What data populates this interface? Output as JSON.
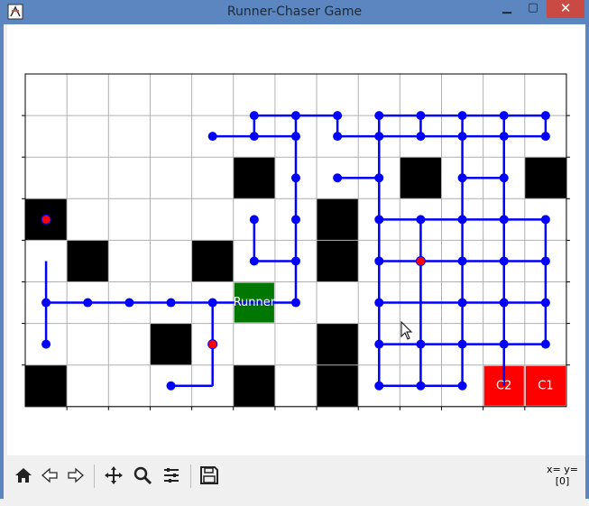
{
  "window": {
    "title": "Runner-Chaser Game"
  },
  "toolbar": {
    "buttons": [
      "home-icon",
      "back-icon",
      "forward-icon",
      "pan-icon",
      "zoom-icon",
      "configure-subplots-icon",
      "save-icon"
    ],
    "coords_line1": "x= y=",
    "coords_line2": "[0]"
  },
  "grid": {
    "cols": 13,
    "rows": 8,
    "grid_color": "#b0b0b0",
    "walls": [
      [
        5,
        2
      ],
      [
        9,
        2
      ],
      [
        12,
        2
      ],
      [
        0,
        3
      ],
      [
        7,
        3
      ],
      [
        1,
        4
      ],
      [
        4,
        4
      ],
      [
        7,
        4
      ],
      [
        3,
        6
      ],
      [
        7,
        6
      ],
      [
        0,
        7
      ],
      [
        5,
        7
      ],
      [
        7,
        7
      ]
    ],
    "runner": {
      "col": 5,
      "row": 5,
      "label": "Runner",
      "color": "#007700"
    },
    "chasers": [
      {
        "col": 11,
        "row": 7,
        "label": "C2",
        "color": "#ff0000"
      },
      {
        "col": 12,
        "row": 7,
        "label": "C1",
        "color": "#ff0000"
      }
    ],
    "edge_color": "#0000ff",
    "node_color": "#0000ff",
    "red_node_color": "#ff0000",
    "red_nodes": [
      [
        0,
        4
      ],
      [
        4,
        7
      ],
      [
        9,
        5
      ]
    ],
    "edges": [
      [
        [
          5.5,
          1
        ],
        [
          6.5,
          1
        ]
      ],
      [
        [
          6.5,
          1
        ],
        [
          7.5,
          1
        ]
      ],
      [
        [
          5.5,
          1
        ],
        [
          5.5,
          1.5
        ]
      ],
      [
        [
          6.5,
          1
        ],
        [
          6.5,
          1.5
        ]
      ],
      [
        [
          7.5,
          1
        ],
        [
          7.5,
          1.5
        ]
      ],
      [
        [
          4.5,
          1.5
        ],
        [
          5.5,
          1.5
        ]
      ],
      [
        [
          5.5,
          1.5
        ],
        [
          6.5,
          1.5
        ]
      ],
      [
        [
          6.5,
          1.5
        ],
        [
          6.5,
          2.5
        ]
      ],
      [
        [
          6.5,
          2.5
        ],
        [
          6.5,
          3.5
        ]
      ],
      [
        [
          6.5,
          3.5
        ],
        [
          6.5,
          4.5
        ]
      ],
      [
        [
          6.5,
          4.5
        ],
        [
          6.5,
          5.5
        ]
      ],
      [
        [
          5.5,
          3.5
        ],
        [
          5.5,
          4.5
        ]
      ],
      [
        [
          5.5,
          4.5
        ],
        [
          6.5,
          4.5
        ]
      ],
      [
        [
          5.5,
          5.5
        ],
        [
          6.5,
          5.5
        ]
      ],
      [
        [
          7.5,
          2.5
        ],
        [
          8.5,
          2.5
        ]
      ],
      [
        [
          7.5,
          1.5
        ],
        [
          8.5,
          1.5
        ]
      ],
      [
        [
          8.5,
          1
        ],
        [
          8.5,
          7.5
        ]
      ],
      [
        [
          9.5,
          1
        ],
        [
          9.5,
          1.5
        ]
      ],
      [
        [
          10.5,
          1
        ],
        [
          10.5,
          1.5
        ]
      ],
      [
        [
          11.5,
          1
        ],
        [
          11.5,
          1.5
        ]
      ],
      [
        [
          12.5,
          1
        ],
        [
          12.5,
          1.5
        ]
      ],
      [
        [
          8.5,
          1
        ],
        [
          12.5,
          1
        ]
      ],
      [
        [
          8.5,
          1.5
        ],
        [
          12.5,
          1.5
        ]
      ],
      [
        [
          10.5,
          1.5
        ],
        [
          10.5,
          2.5
        ]
      ],
      [
        [
          11.5,
          1.5
        ],
        [
          11.5,
          2.5
        ]
      ],
      [
        [
          10.5,
          2.5
        ],
        [
          11.5,
          2.5
        ]
      ],
      [
        [
          8.5,
          3.5
        ],
        [
          12.5,
          3.5
        ]
      ],
      [
        [
          8.5,
          4.5
        ],
        [
          12.5,
          4.5
        ]
      ],
      [
        [
          8.5,
          5.5
        ],
        [
          12.5,
          5.5
        ]
      ],
      [
        [
          8.5,
          6.5
        ],
        [
          12.5,
          6.5
        ]
      ],
      [
        [
          8.5,
          7.5
        ],
        [
          10.5,
          7.5
        ]
      ],
      [
        [
          9.5,
          3.5
        ],
        [
          9.5,
          7.5
        ]
      ],
      [
        [
          10.5,
          2.5
        ],
        [
          10.5,
          7.5
        ]
      ],
      [
        [
          11.5,
          2.5
        ],
        [
          11.5,
          7.5
        ]
      ],
      [
        [
          12.5,
          3.5
        ],
        [
          12.5,
          6.5
        ]
      ],
      [
        [
          0.5,
          4.5
        ],
        [
          0.5,
          6.5
        ]
      ],
      [
        [
          0.5,
          5.5
        ],
        [
          5.5,
          5.5
        ]
      ],
      [
        [
          4.5,
          5.5
        ],
        [
          4.5,
          7.5
        ]
      ],
      [
        [
          3.5,
          7.5
        ],
        [
          4.5,
          7.5
        ]
      ]
    ],
    "nodes": [
      [
        5.5,
        1
      ],
      [
        6.5,
        1
      ],
      [
        7.5,
        1
      ],
      [
        8.5,
        1
      ],
      [
        9.5,
        1
      ],
      [
        10.5,
        1
      ],
      [
        11.5,
        1
      ],
      [
        12.5,
        1
      ],
      [
        4.5,
        1.5
      ],
      [
        5.5,
        1.5
      ],
      [
        6.5,
        1.5
      ],
      [
        7.5,
        1.5
      ],
      [
        8.5,
        1.5
      ],
      [
        9.5,
        1.5
      ],
      [
        10.5,
        1.5
      ],
      [
        11.5,
        1.5
      ],
      [
        12.5,
        1.5
      ],
      [
        6.5,
        2.5
      ],
      [
        7.5,
        2.5
      ],
      [
        8.5,
        2.5
      ],
      [
        10.5,
        2.5
      ],
      [
        11.5,
        2.5
      ],
      [
        5.5,
        3.5
      ],
      [
        6.5,
        3.5
      ],
      [
        8.5,
        3.5
      ],
      [
        9.5,
        3.5
      ],
      [
        10.5,
        3.5
      ],
      [
        11.5,
        3.5
      ],
      [
        12.5,
        3.5
      ],
      [
        5.5,
        4.5
      ],
      [
        6.5,
        4.5
      ],
      [
        8.5,
        4.5
      ],
      [
        9.5,
        4.5
      ],
      [
        10.5,
        4.5
      ],
      [
        11.5,
        4.5
      ],
      [
        12.5,
        4.5
      ],
      [
        0.5,
        5.5
      ],
      [
        1.5,
        5.5
      ],
      [
        2.5,
        5.5
      ],
      [
        3.5,
        5.5
      ],
      [
        4.5,
        5.5
      ],
      [
        6.5,
        5.5
      ],
      [
        8.5,
        5.5
      ],
      [
        10.5,
        5.5
      ],
      [
        11.5,
        5.5
      ],
      [
        12.5,
        5.5
      ],
      [
        0.5,
        6.5
      ],
      [
        4.5,
        6.5
      ],
      [
        8.5,
        6.5
      ],
      [
        9.5,
        6.5
      ],
      [
        10.5,
        6.5
      ],
      [
        11.5,
        6.5
      ],
      [
        12.5,
        6.5
      ],
      [
        3.5,
        7.5
      ],
      [
        8.5,
        7.5
      ],
      [
        9.5,
        7.5
      ],
      [
        10.5,
        7.5
      ]
    ]
  }
}
